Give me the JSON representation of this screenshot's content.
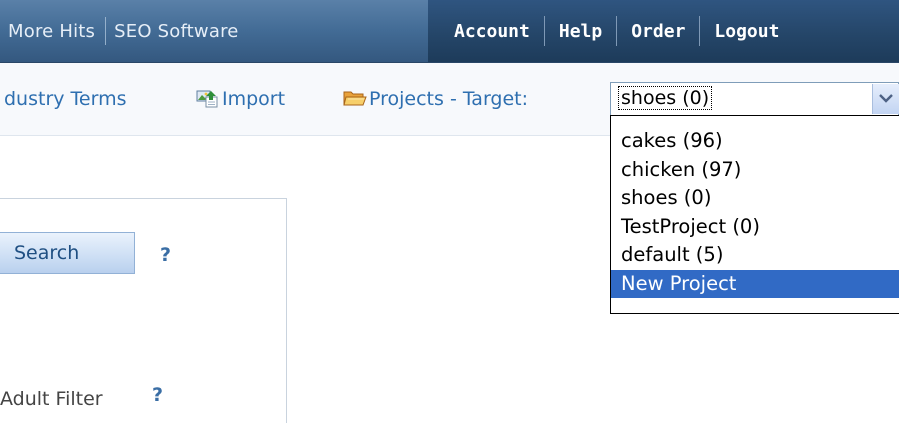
{
  "topbar": {
    "left_links": [
      "More Hits",
      "SEO Software"
    ],
    "nav": [
      "Account",
      "Help",
      "Order",
      "Logout"
    ]
  },
  "toolbar": {
    "terms_label": "dustry Terms",
    "import_label": "Import",
    "projects_label": "Projects - Target:"
  },
  "project_select": {
    "value": "shoes (0)",
    "options": [
      "cakes (96)",
      "chicken (97)",
      "shoes (0)",
      "TestProject (0)",
      "default (5)",
      "New Project"
    ],
    "highlighted": "New Project"
  },
  "panel": {
    "search_button": "Search",
    "help": "?",
    "adult_filter_label": "Adult Filter",
    "adult_filter_help": "?"
  },
  "colors": {
    "nav_bg": "#254669",
    "link": "#2e6fb0",
    "highlight": "#316ac5"
  }
}
